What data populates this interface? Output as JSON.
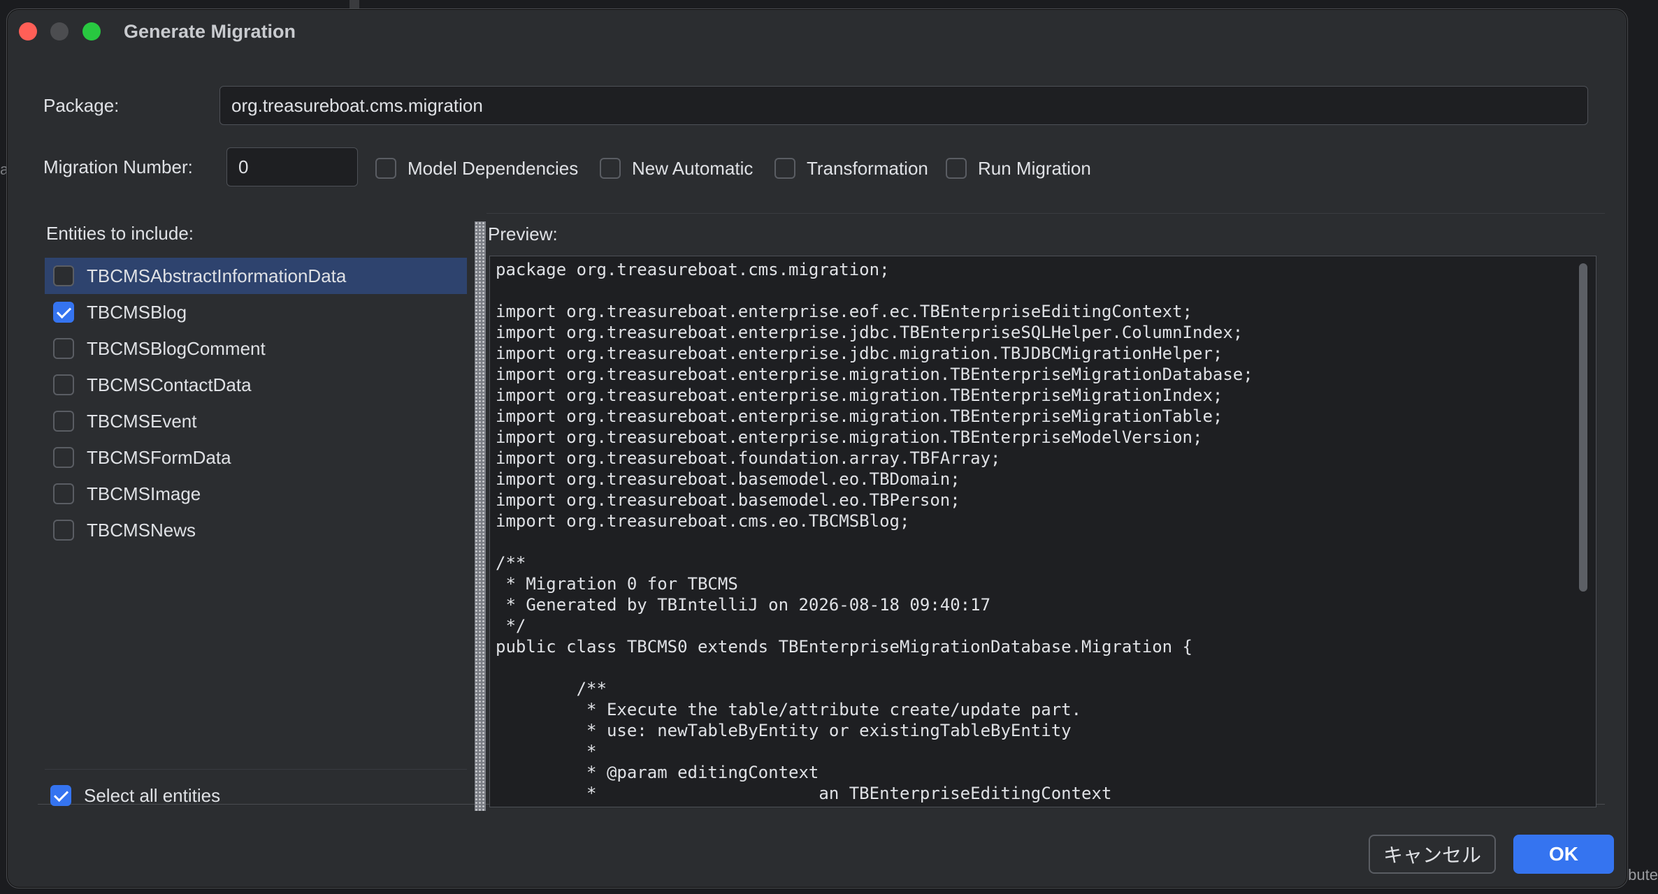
{
  "window": {
    "title": "Generate Migration"
  },
  "background": {
    "corner_text": "ibute",
    "left_text": "a"
  },
  "form": {
    "package_label": "Package:",
    "package_value": "org.treasureboat.cms.migration",
    "migration_number_label": "Migration Number:",
    "migration_number_value": "0",
    "options": [
      {
        "label": "Model Dependencies",
        "checked": false
      },
      {
        "label": "New Automatic",
        "checked": false
      },
      {
        "label": "Transformation",
        "checked": false
      },
      {
        "label": "Run Migration",
        "checked": false
      }
    ]
  },
  "entities": {
    "header": "Entities to include:",
    "items": [
      {
        "label": "TBCMSAbstractInformationData",
        "checked": false,
        "selected": true
      },
      {
        "label": "TBCMSBlog",
        "checked": true,
        "selected": false
      },
      {
        "label": "TBCMSBlogComment",
        "checked": false,
        "selected": false
      },
      {
        "label": "TBCMSContactData",
        "checked": false,
        "selected": false
      },
      {
        "label": "TBCMSEvent",
        "checked": false,
        "selected": false
      },
      {
        "label": "TBCMSFormData",
        "checked": false,
        "selected": false
      },
      {
        "label": "TBCMSImage",
        "checked": false,
        "selected": false
      },
      {
        "label": "TBCMSNews",
        "checked": false,
        "selected": false
      }
    ],
    "select_all_label": "Select all entities",
    "select_all_checked": true
  },
  "preview": {
    "header": "Preview:",
    "code": "package org.treasureboat.cms.migration;\n\nimport org.treasureboat.enterprise.eof.ec.TBEnterpriseEditingContext;\nimport org.treasureboat.enterprise.jdbc.TBEnterpriseSQLHelper.ColumnIndex;\nimport org.treasureboat.enterprise.jdbc.migration.TBJDBCMigrationHelper;\nimport org.treasureboat.enterprise.migration.TBEnterpriseMigrationDatabase;\nimport org.treasureboat.enterprise.migration.TBEnterpriseMigrationIndex;\nimport org.treasureboat.enterprise.migration.TBEnterpriseMigrationTable;\nimport org.treasureboat.enterprise.migration.TBEnterpriseModelVersion;\nimport org.treasureboat.foundation.array.TBFArray;\nimport org.treasureboat.basemodel.eo.TBDomain;\nimport org.treasureboat.basemodel.eo.TBPerson;\nimport org.treasureboat.cms.eo.TBCMSBlog;\n\n/**\n * Migration 0 for TBCMS\n * Generated by TBIntelliJ on 2026-08-18 09:40:17\n */\npublic class TBCMS0 extends TBEnterpriseMigrationDatabase.Migration {\n\n        /**\n         * Execute the table/attribute create/update part.\n         * use: newTableByEntity or existingTableByEntity\n         *\n         * @param editingContext\n         *                      an TBEnterpriseEditingContext"
  },
  "buttons": {
    "cancel_label": "キャンセル",
    "ok_label": "OK"
  },
  "colors": {
    "accent": "#3574f0",
    "selection": "#2e436e",
    "dialog_bg": "#2b2d30",
    "editor_bg": "#1e1f22"
  }
}
